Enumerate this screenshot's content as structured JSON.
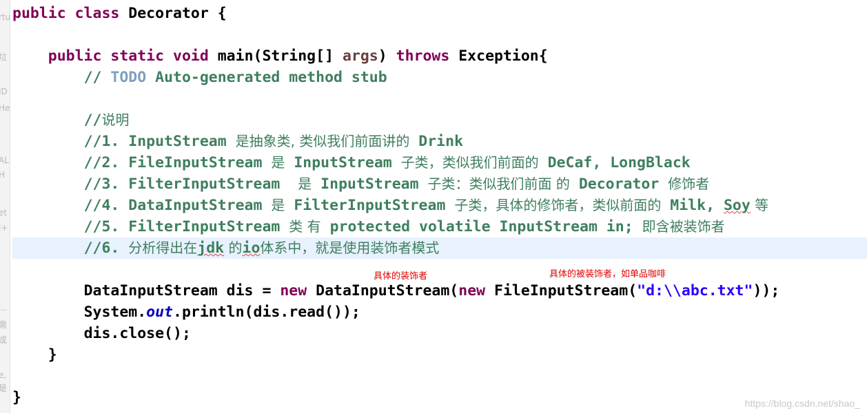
{
  "gutter": [
    "rtu",
    "垃",
    "ID",
    "He",
    "AL",
    "H",
    "et",
    "l+",
    "...",
    "需",
    "或",
    "e,",
    "是"
  ],
  "code": {
    "class_decl": {
      "kw": "public class ",
      "name": "Decorator {"
    },
    "main_decl": {
      "kw1": "public static void ",
      "name": "main(String[] ",
      "args": "args",
      "close": ") ",
      "kw2": "throws ",
      "rest": "Exception{"
    },
    "todo": {
      "prefix": "// ",
      "tag": "TODO",
      "rest": " Auto-generated method stub"
    },
    "c0": {
      "prefix": "//",
      "text": "说明"
    },
    "c1": {
      "a": "//1. InputStream ",
      "b": "是抽象类, 类似我们前面讲的",
      "c": " Drink"
    },
    "c2": {
      "a": "//2. FileInputStream ",
      "b": "是",
      "c": " InputStream ",
      "d": "子类，类似我们前面的",
      "e": " DeCaf, LongBlack"
    },
    "c3": {
      "a": "//3. FilterInputStream  ",
      "b": "是",
      "c": " InputStream ",
      "d": "子类：类似我们前面",
      "e": " 的",
      "f": " Decorator ",
      "g": "修饰者"
    },
    "c4": {
      "a": "//4. DataInputStream ",
      "b": "是",
      "c": " FilterInputStream ",
      "d": "子类，具体的修饰者，类似前面的",
      "e": " Milk, ",
      "soy": "Soy",
      "f": " 等"
    },
    "c5": {
      "a": "//5. FilterInputStream ",
      "b": "类 有",
      "c": " protected volatile InputStream in; ",
      "d": "即含被装饰者"
    },
    "c6": {
      "a": "//6. ",
      "b": "分析得出在",
      "jdk": "jdk",
      "c": " 的",
      "io": "io",
      "d": "体系中，就是使用装饰者模式"
    },
    "decl": {
      "a": "DataInputStream dis = ",
      "kw1": "new",
      "b": " DataInputStream(",
      "kw2": "new",
      "c": " FileInputStream(",
      "str": "\"d:\\\\abc.txt\"",
      "d": "));"
    },
    "println": {
      "a": "System.",
      "field": "out",
      "b": ".println(dis.read());"
    },
    "close": {
      "text": "dis.close();"
    },
    "brace1": "}",
    "brace2": "}"
  },
  "annotations": {
    "decorator": "具体的装饰者",
    "decorated": "具体的被装饰者，如单品咖啡"
  },
  "watermark": "https://blog.csdn.net/shao_",
  "colors": {
    "keyword": "#7f0055",
    "comment": "#3f7f5f",
    "todo": "#7f9fbf",
    "field": "#0000c0",
    "string": "#2a00ff",
    "annotation": "#e00000",
    "current_line": "#e8f2fe"
  }
}
